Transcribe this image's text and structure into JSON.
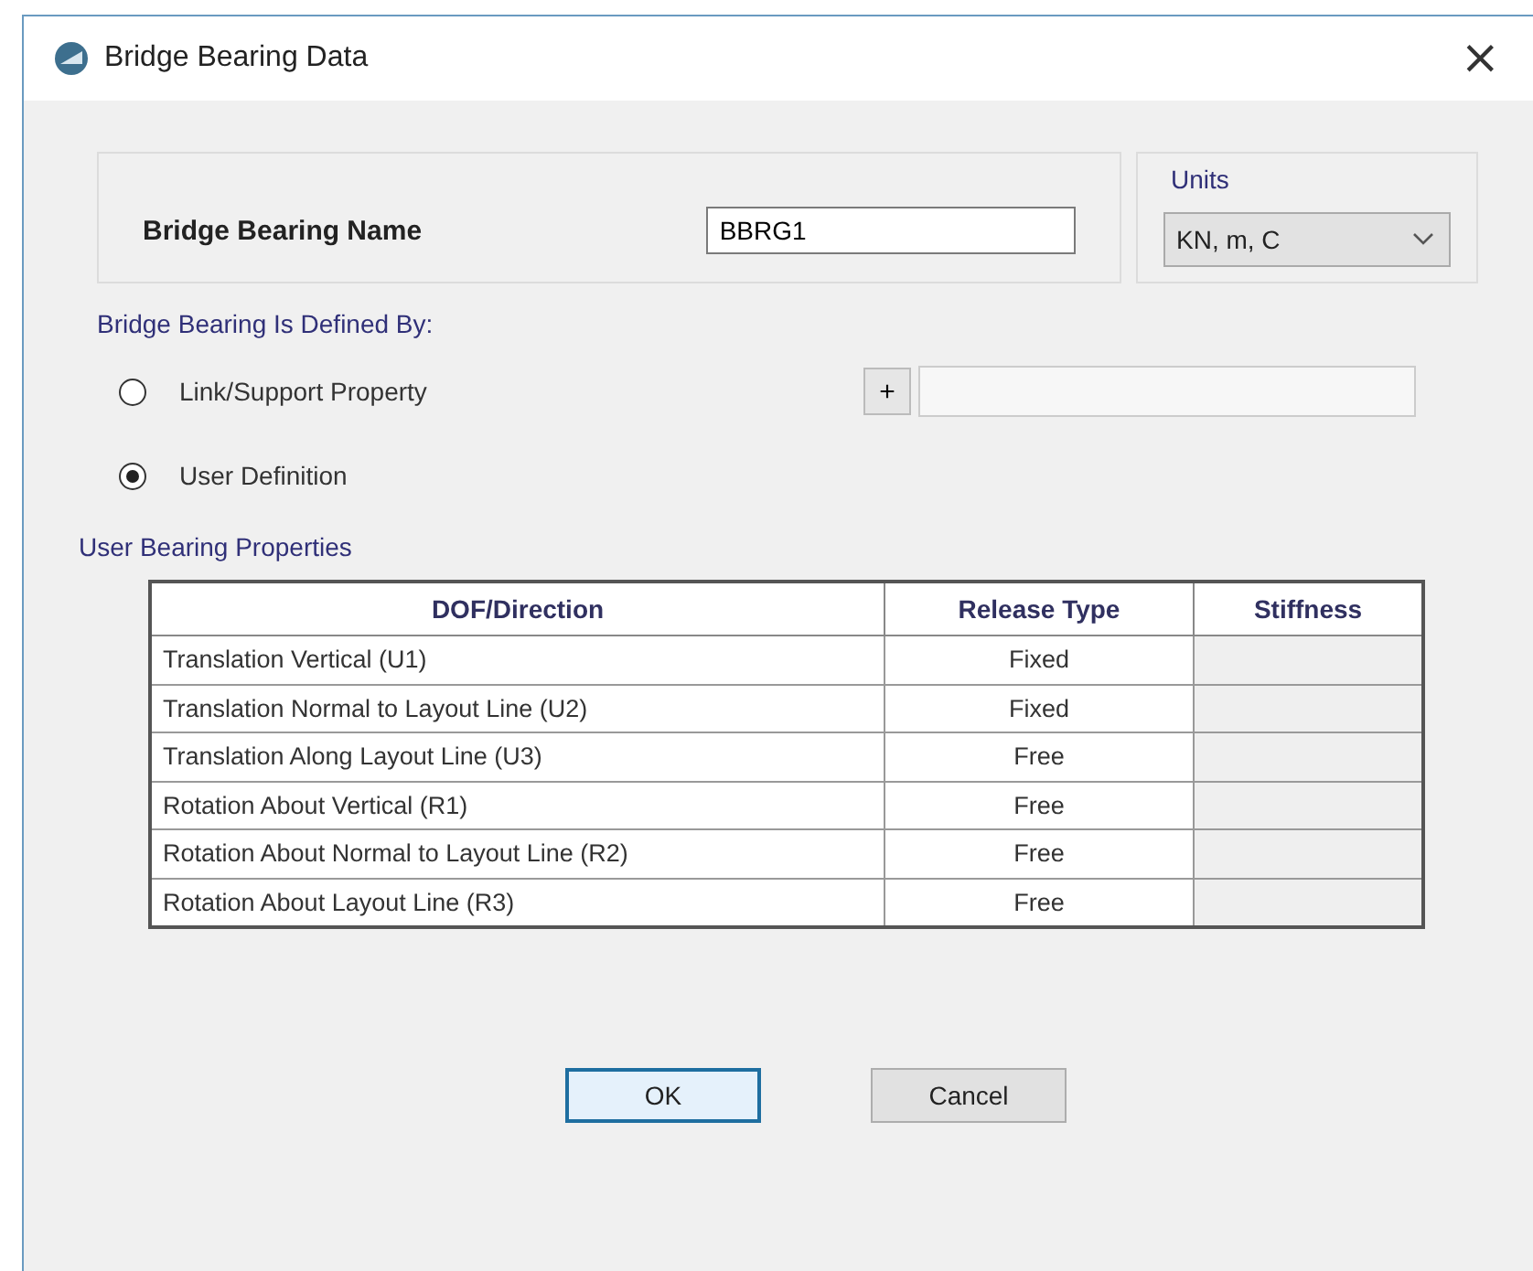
{
  "window": {
    "title": "Bridge Bearing Data",
    "close": "×"
  },
  "name_field": {
    "label": "Bridge Bearing Name",
    "value": "BBRG1"
  },
  "units": {
    "label": "Units",
    "value": "KN, m, C"
  },
  "defined_by": {
    "label": "Bridge Bearing Is Defined By:",
    "options": [
      {
        "label": "Link/Support Property",
        "selected": false
      },
      {
        "label": "User Definition",
        "selected": true
      }
    ],
    "add_button": "+"
  },
  "table": {
    "title": "User Bearing Properties",
    "columns": [
      "DOF/Direction",
      "Release Type",
      "Stiffness"
    ],
    "rows": [
      {
        "dof": "Translation Vertical (U1)",
        "release_type": "Fixed"
      },
      {
        "dof": "Translation Normal to Layout Line (U2)",
        "release_type": "Fixed"
      },
      {
        "dof": "Translation Along Layout Line (U3)",
        "release_type": "Free"
      },
      {
        "dof": "Rotation About Vertical (R1)",
        "release_type": "Free"
      },
      {
        "dof": "Rotation About Normal to Layout Line (R2)",
        "release_type": "Free"
      },
      {
        "dof": "Rotation About Layout Line (R3)",
        "release_type": "Free"
      }
    ]
  },
  "buttons": [
    {
      "label": "OK",
      "default": true
    },
    {
      "label": "Cancel",
      "default": false
    }
  ]
}
